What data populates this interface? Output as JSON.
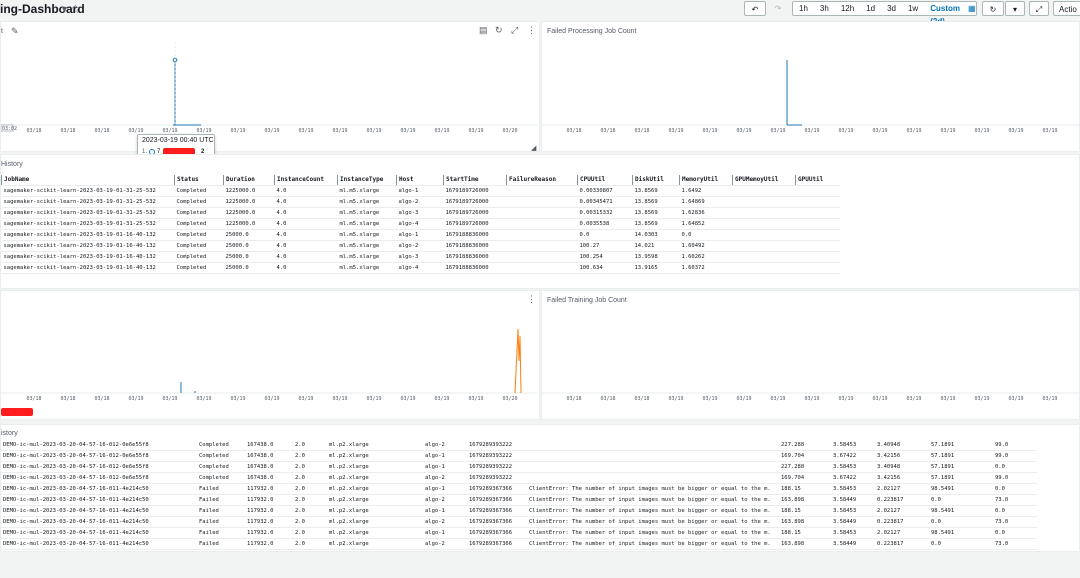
{
  "header": {
    "title": "ing-Dashboard",
    "time_ranges": [
      "1h",
      "3h",
      "12h",
      "1d",
      "3d",
      "1w",
      "Custom (2d)"
    ],
    "actions_label": "Actio"
  },
  "panels": {
    "top_left": {
      "title": "t",
      "x_ticks": [
        "03/18",
        "03/18",
        "03/18",
        "03/19",
        "03/19",
        "03/19",
        "03/19",
        "03/19",
        "03/19",
        "03/19",
        "03/19",
        "03/19",
        "03/19",
        "03/19",
        "03/20"
      ],
      "corner_label": "03:02"
    },
    "top_right": {
      "title": "Failed Processing Job Count",
      "x_ticks": [
        "03/18",
        "03/18",
        "03/18",
        "03/19",
        "03/19",
        "03/19",
        "03/19",
        "03/19",
        "03/19",
        "03/19",
        "03/19",
        "03/19",
        "03/19",
        "03/19",
        "03/19"
      ]
    },
    "mid_left": {
      "x_ticks": [
        "03/18",
        "03/18",
        "03/18",
        "03/19",
        "03/19",
        "03/19",
        "03/19",
        "03/19",
        "03/19",
        "03/19",
        "03/19",
        "03/19",
        "03/19",
        "03/19",
        "03/20"
      ]
    },
    "mid_right": {
      "title": "Failed Training Job Count",
      "x_ticks": [
        "03/18",
        "03/18",
        "03/18",
        "03/19",
        "03/19",
        "03/19",
        "03/19",
        "03/19",
        "03/19",
        "03/19",
        "03/19",
        "03/19",
        "03/19",
        "03/19",
        "03/19"
      ]
    }
  },
  "tooltip": {
    "time": "2023-03-19 00:40 UTC",
    "row_prefix": "1.",
    "row_value_start": "7",
    "row_value_end": "2"
  },
  "processing_history": {
    "title": "History",
    "columns": [
      "JobName",
      "Status",
      "Duration",
      "InstanceCount",
      "InstanceType",
      "Host",
      "StartTime",
      "FailureReason",
      "CPUUtil",
      "DiskUtil",
      "MemoryUtil",
      "GPUMemoyUtil",
      "GPUUtil"
    ],
    "rows": [
      [
        "sagemaker-scikit-learn-2023-03-19-01-31-25-532",
        "Completed",
        "1225000.0",
        "4.0",
        "ml.m5.xlarge",
        "algo-1",
        "1679189726000",
        "",
        "0.00330807",
        "13.8569",
        "1.6492",
        "",
        ""
      ],
      [
        "sagemaker-scikit-learn-2023-03-19-01-31-25-532",
        "Completed",
        "1225000.0",
        "4.0",
        "ml.m5.xlarge",
        "algo-2",
        "1679189726000",
        "",
        "0.00345471",
        "13.8569",
        "1.64869",
        "",
        ""
      ],
      [
        "sagemaker-scikit-learn-2023-03-19-01-31-25-532",
        "Completed",
        "1225000.0",
        "4.0",
        "ml.m5.xlarge",
        "algo-3",
        "1679189726000",
        "",
        "0.00315332",
        "13.8569",
        "1.62836",
        "",
        ""
      ],
      [
        "sagemaker-scikit-learn-2023-03-19-01-31-25-532",
        "Completed",
        "1225000.0",
        "4.0",
        "ml.m5.xlarge",
        "algo-4",
        "1679189726000",
        "",
        "0.0035538",
        "13.8569",
        "1.64852",
        "",
        ""
      ],
      [
        "sagemaker-scikit-learn-2023-03-19-01-16-40-132",
        "Completed",
        "25000.0",
        "4.0",
        "ml.m5.xlarge",
        "algo-1",
        "1679188836000",
        "",
        "0.0",
        "14.0303",
        "0.0",
        "",
        ""
      ],
      [
        "sagemaker-scikit-learn-2023-03-19-01-16-40-132",
        "Completed",
        "25000.0",
        "4.0",
        "ml.m5.xlarge",
        "algo-2",
        "1679188836000",
        "",
        "100.27",
        "14.021",
        "1.60492",
        "",
        ""
      ],
      [
        "sagemaker-scikit-learn-2023-03-19-01-16-40-132",
        "Completed",
        "25000.0",
        "4.0",
        "ml.m5.xlarge",
        "algo-3",
        "1679188836000",
        "",
        "100.254",
        "13.9598",
        "1.60262",
        "",
        ""
      ],
      [
        "sagemaker-scikit-learn-2023-03-19-01-16-40-132",
        "Completed",
        "25000.0",
        "4.0",
        "ml.m5.xlarge",
        "algo-4",
        "1679188836000",
        "",
        "100.634",
        "13.9165",
        "1.60372",
        "",
        ""
      ]
    ]
  },
  "training_history": {
    "title": "istory",
    "rows": [
      [
        "DEMO-ic-mul-2023-03-20-04-57-16-012-0e6e55f8",
        "Completed",
        "167438.0",
        "2.0",
        "ml.p2.xlarge",
        "algo-2",
        "1679289393222",
        "",
        "227.288",
        "3.58453",
        "3.40948",
        "57.1891",
        "99.0"
      ],
      [
        "DEMO-ic-mul-2023-03-20-04-57-16-012-0e6e55f8",
        "Completed",
        "167438.0",
        "2.0",
        "ml.p2.xlarge",
        "algo-1",
        "1679289393222",
        "",
        "169.704",
        "3.67422",
        "3.42156",
        "57.1891",
        "99.0"
      ],
      [
        "DEMO-ic-mul-2023-03-20-04-57-16-012-0e6e55f8",
        "Completed",
        "167438.0",
        "2.0",
        "ml.p2.xlarge",
        "algo-1",
        "1679289393222",
        "",
        "227.288",
        "3.58453",
        "3.40948",
        "57.1891",
        "0.0"
      ],
      [
        "DEMO-ic-mul-2023-03-20-04-57-16-012-0e6e55f8",
        "Completed",
        "167438.0",
        "2.0",
        "ml.p2.xlarge",
        "algo-2",
        "1679289393222",
        "",
        "169.704",
        "3.67422",
        "3.42156",
        "57.1891",
        "99.0"
      ],
      [
        "DEMO-ic-mul-2023-03-20-04-57-16-011-4e214c50",
        "Failed",
        "117932.0",
        "2.0",
        "ml.p2.xlarge",
        "algo-1",
        "1679289367366",
        "ClientError: The number of input images must be bigger or equal to the m.",
        "188.15",
        "3.58453",
        "2.02127",
        "98.5491",
        "0.0"
      ],
      [
        "DEMO-ic-mul-2023-03-20-04-57-16-011-4e214c50",
        "Failed",
        "117932.0",
        "2.0",
        "ml.p2.xlarge",
        "algo-2",
        "1679289367366",
        "ClientError: The number of input images must be bigger or equal to the m.",
        "163.898",
        "3.58449",
        "0.223817",
        "0.0",
        "73.0"
      ],
      [
        "DEMO-ic-mul-2023-03-20-04-57-16-011-4e214c50",
        "Failed",
        "117932.0",
        "2.0",
        "ml.p2.xlarge",
        "algo-1",
        "1679289367366",
        "ClientError: The number of input images must be bigger or equal to the m.",
        "188.15",
        "3.58453",
        "2.02127",
        "98.5491",
        "0.0"
      ],
      [
        "DEMO-ic-mul-2023-03-20-04-57-16-011-4e214c50",
        "Failed",
        "117932.0",
        "2.0",
        "ml.p2.xlarge",
        "algo-2",
        "1679289367366",
        "ClientError: The number of input images must be bigger or equal to the m.",
        "163.898",
        "3.58449",
        "0.223817",
        "0.0",
        "73.0"
      ],
      [
        "DEMO-ic-mul-2023-03-20-04-57-16-011-4e214c50",
        "Failed",
        "117932.0",
        "2.0",
        "ml.p2.xlarge",
        "algo-1",
        "1679289367366",
        "ClientError: The number of input images must be bigger or equal to the m.",
        "188.15",
        "3.58453",
        "2.02127",
        "98.5491",
        "0.0"
      ],
      [
        "DEMO-ic-mul-2023-03-20-04-57-16-011-4e214c50",
        "Failed",
        "117932.0",
        "2.0",
        "ml.p2.xlarge",
        "algo-2",
        "1679289367366",
        "ClientError: The number of input images must be bigger or equal to the m.",
        "163.898",
        "3.58449",
        "0.223817",
        "0.0",
        "73.0"
      ]
    ]
  },
  "colors": {
    "accent": "#0073bb",
    "series_blue": "#1f77b4",
    "series_orange": "#ff7f0e",
    "redaction": "#ff1c1c"
  },
  "icons": [
    "star-icon",
    "edit-icon",
    "undo-icon",
    "redo-icon",
    "calendar-icon",
    "refresh-icon",
    "caret-down-icon",
    "fullscreen-icon",
    "export-icon",
    "expand-icon",
    "more-icon"
  ]
}
